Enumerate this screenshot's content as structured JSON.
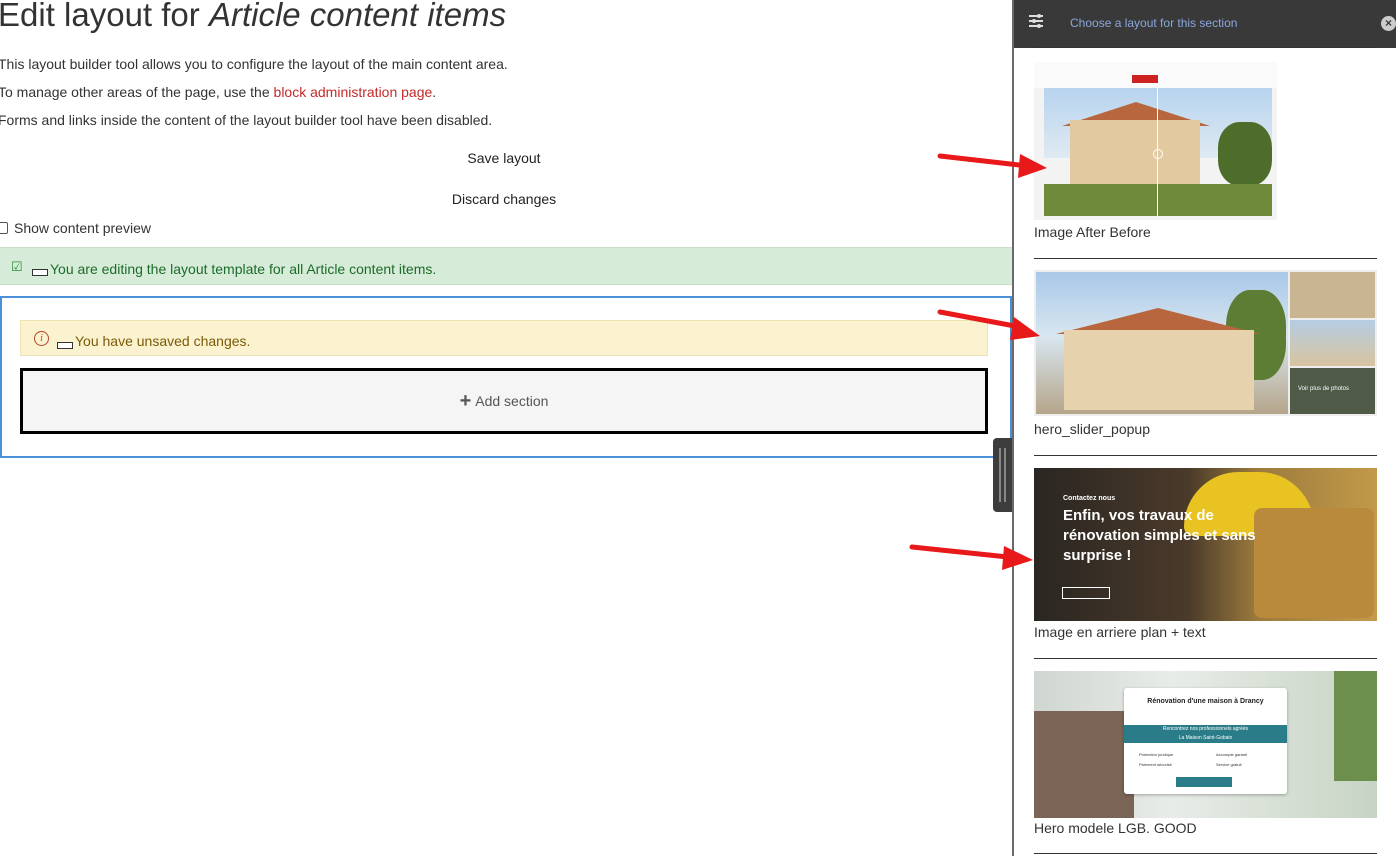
{
  "page": {
    "title_prefix": "Edit layout for ",
    "title_entity": "Article content items",
    "intro": "This layout builder tool allows you to configure the layout of the main content area.",
    "manage_prefix": "To manage other areas of the page, use the ",
    "manage_link": "block administration page",
    "manage_suffix": ".",
    "disabled_note": "Forms and links inside the content of the layout builder tool have been disabled.",
    "save_label": "Save layout",
    "discard_label": "Discard changes",
    "preview_label": "Show content preview",
    "status_message": "You are editing the layout template for all Article content items.",
    "warning_message": "You have unsaved changes.",
    "add_section_label": "Add section"
  },
  "panel": {
    "title": "Choose a layout for this section",
    "close_glyph": "×",
    "layouts": [
      {
        "label": "Image After Before"
      },
      {
        "label": "hero_slider_popup"
      },
      {
        "label": "Image en arriere plan + text"
      },
      {
        "label": "Hero modele LGB. GOOD"
      }
    ]
  },
  "thumbs": {
    "t2_label": "Voir plus de photos",
    "t3_small": "Contactez nous",
    "t3_heading": "Enfin, vos travaux de rénovation simples et sans surprise !",
    "t4_title": "Rénovation d'une maison à Drancy",
    "t4_band1": "Rencontrez nos professionnels agréés",
    "t4_band2": "La Maison Saint-Gobain",
    "t4_items": [
      "Protection juridique",
      "Paiement sécurisé",
      "Accompte garanti",
      "Service gratuit"
    ]
  },
  "colors": {
    "accent_blue": "#4a90d9",
    "link_red": "#c42a2a",
    "status_green": "#d6ecd8",
    "warning_yellow": "#fbf2cf",
    "panel_header": "#393939",
    "arrow_red": "#e8191a"
  }
}
